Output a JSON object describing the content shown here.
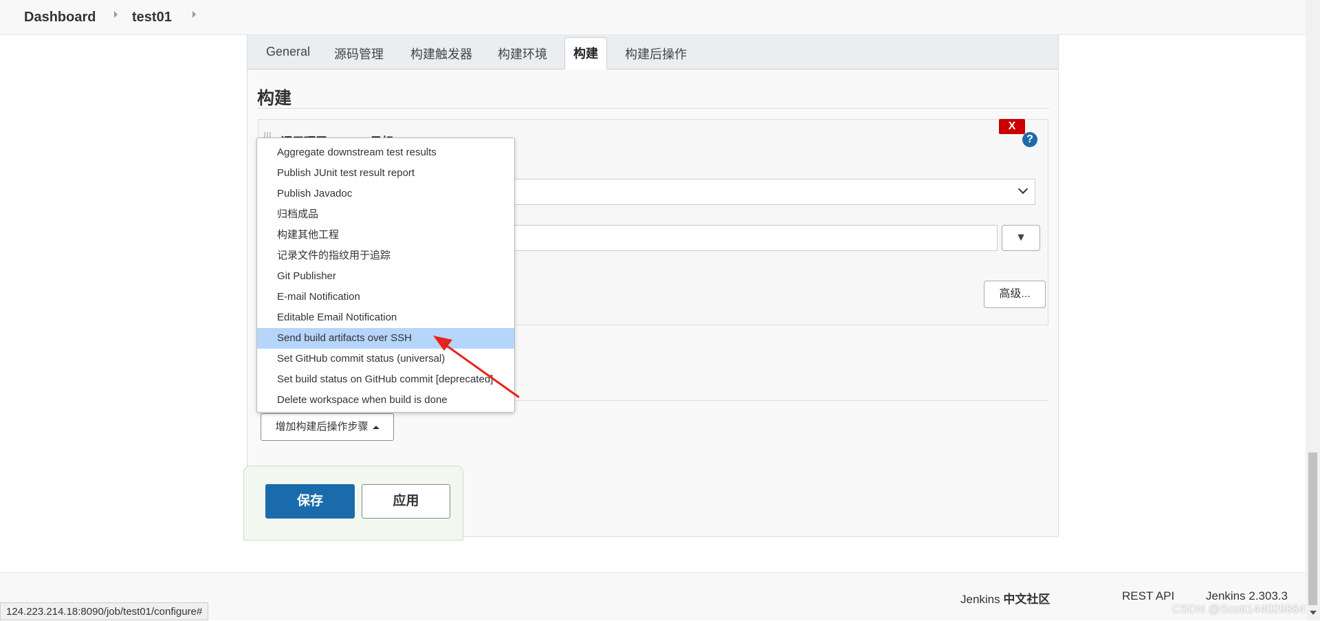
{
  "breadcrumb": {
    "dashboard": "Dashboard",
    "job": "test01"
  },
  "tabs": [
    {
      "label": "General"
    },
    {
      "label": "源码管理"
    },
    {
      "label": "构建触发器"
    },
    {
      "label": "构建环境"
    },
    {
      "label": "构建",
      "active": true
    },
    {
      "label": "构建后操作"
    }
  ],
  "section": {
    "title": "构建"
  },
  "build_step": {
    "title": "调用顶层 Maven 目标",
    "delete_label": "X",
    "help_label": "?",
    "expand_label": "▼",
    "advanced_label": "高级..."
  },
  "add_post_step_label": "增加构建后操作步骤",
  "menu": {
    "items": [
      "Aggregate downstream test results",
      "Publish JUnit test result report",
      "Publish Javadoc",
      "归档成品",
      "构建其他工程",
      "记录文件的指纹用于追踪",
      "Git Publisher",
      "E-mail Notification",
      "Editable Email Notification",
      "Send build artifacts over SSH",
      "Set GitHub commit status (universal)",
      "Set build status on GitHub commit [deprecated]",
      "Delete workspace when build is done"
    ],
    "highlighted_index": 9
  },
  "actions": {
    "save_label": "保存",
    "apply_label": "应用"
  },
  "footer": {
    "community_prefix": "Jenkins",
    "community_strong": "中文社区",
    "rest_api": "REST API",
    "version": "Jenkins 2.303.3"
  },
  "status_url": "124.223.214.18:8090/job/test01/configure#",
  "watermark": "CSDN @Scott1440298847",
  "colors": {
    "primary_button": "#1a6bab",
    "delete_button": "#cc0000",
    "menu_highlight": "#b5d5fb",
    "annotation_arrow": "#e8231a"
  }
}
